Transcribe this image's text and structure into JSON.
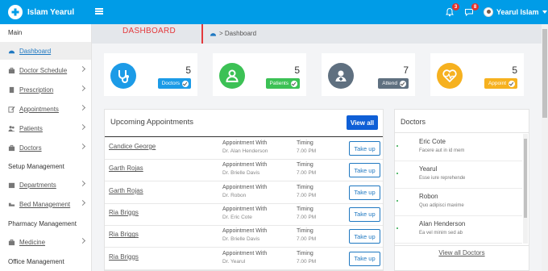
{
  "header": {
    "app_name": "Islam Yearul",
    "notifications_count": "3",
    "messages_count": "8",
    "user_name": "Yearul Islam"
  },
  "sidebar": {
    "section_main": "Main",
    "section_setup": "Setup Management",
    "section_pharmacy": "Pharmacy Management",
    "section_office": "Office Management",
    "items": [
      {
        "label": "Dashboard",
        "icon": "dashboard-icon"
      },
      {
        "label": "Doctor Schedule",
        "icon": "briefcase-icon"
      },
      {
        "label": "Prescription",
        "icon": "prescription-icon"
      },
      {
        "label": "Appointments",
        "icon": "edit-icon"
      },
      {
        "label": "Patients",
        "icon": "users-icon"
      },
      {
        "label": "Doctors",
        "icon": "doctor-icon"
      },
      {
        "label": "Departments",
        "icon": "building-icon"
      },
      {
        "label": "Bed Management",
        "icon": "bed-icon"
      },
      {
        "label": "Medicine",
        "icon": "medicine-icon"
      }
    ]
  },
  "page": {
    "title": "DASHBOARD",
    "breadcrumb": "> Dashboard"
  },
  "stats": [
    {
      "value": "5",
      "label": "Doctors",
      "color": "#1c9be7"
    },
    {
      "value": "5",
      "label": "Patients",
      "color": "#3cc155"
    },
    {
      "value": "7",
      "label": "Attend",
      "color": "#5f7080"
    },
    {
      "value": "5",
      "label": "Appoint",
      "color": "#f6b11f"
    }
  ],
  "appointments": {
    "title": "Upcoming Appointments",
    "view_all": "View all",
    "with_label": "Appointment With",
    "timing_label": "Timing",
    "action_label": "Take up",
    "rows": [
      {
        "patient": "Candice George",
        "doctor": "Dr. Alan Henderson",
        "time": "7.00 PM"
      },
      {
        "patient": "Garth Rojas",
        "doctor": "Dr. Brielle Davis",
        "time": "7.00 PM"
      },
      {
        "patient": "Garth Rojas",
        "doctor": "Dr. Robon",
        "time": "7.00 PM"
      },
      {
        "patient": "Ria Briggs",
        "doctor": "Dr. Eric Cote",
        "time": "7.00 PM"
      },
      {
        "patient": "Ria Briggs",
        "doctor": "Dr. Brielle Davis",
        "time": "7.00 PM"
      },
      {
        "patient": "Ria Briggs",
        "doctor": "Dr. Yearul",
        "time": "7.00 PM"
      }
    ]
  },
  "doctors": {
    "title": "Doctors",
    "view_all": "View all Doctors",
    "items": [
      {
        "name": "Eric Cote",
        "desc": "Facere aut in id mem"
      },
      {
        "name": "Yearul",
        "desc": "Esse iure reprehende"
      },
      {
        "name": "Robon",
        "desc": "Quo adipisci maxime"
      },
      {
        "name": "Alan Henderson",
        "desc": "Ea vel minim sed ab"
      }
    ]
  }
}
